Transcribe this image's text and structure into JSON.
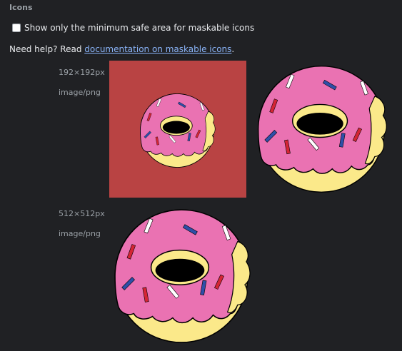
{
  "section": {
    "title": "Icons"
  },
  "safe_area_option": {
    "label": "Show only the minimum safe area for maskable icons",
    "checked": false
  },
  "help": {
    "prefix": "Need help? Read ",
    "link_text": "documentation on maskable icons",
    "suffix": "."
  },
  "icons": [
    {
      "size": "192×192px",
      "type": "image/png",
      "maskable_background": "#b94343"
    },
    {
      "size": "512×512px",
      "type": "image/png"
    }
  ],
  "colors": {
    "page_background": "#202124",
    "donut_icing": "#ea72b2",
    "donut_dough": "#fbe98a",
    "link": "#8ab4f8"
  }
}
